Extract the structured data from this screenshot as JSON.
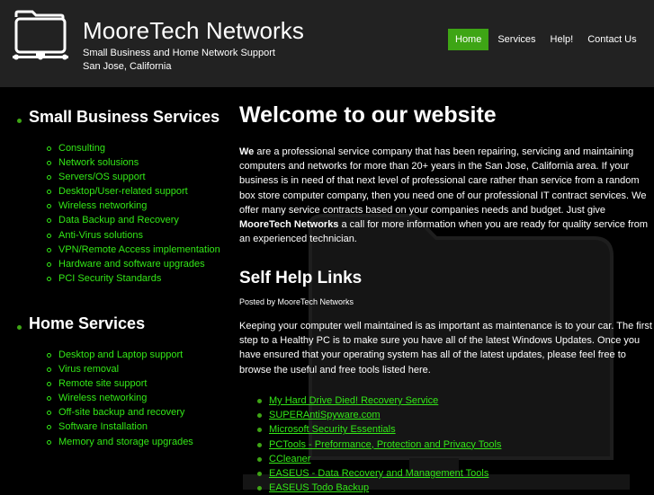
{
  "header": {
    "title": "MooreTech Networks",
    "tagline": "Small Business and Home Network Support",
    "location": "San Jose, California",
    "logo_icon": "computer-folder-icon"
  },
  "nav": {
    "items": [
      {
        "label": "Home",
        "active": true
      },
      {
        "label": "Services",
        "active": false
      },
      {
        "label": "Help!",
        "active": false
      },
      {
        "label": "Contact Us",
        "active": false
      }
    ]
  },
  "sidebar": {
    "small_business": {
      "heading": "Small Business Services",
      "items": [
        "Consulting",
        "Network solusions",
        "Servers/OS support",
        "Desktop/User-related support",
        "Wireless networking",
        "Data Backup and Recovery",
        "Anti-Virus solutions",
        "VPN/Remote Access implementation",
        "Hardware and software upgrades",
        "PCI Security Standards"
      ]
    },
    "home": {
      "heading": "Home Services",
      "items": [
        "Desktop and Laptop support",
        "Virus removal",
        "Remote site support",
        "Wireless networking",
        "Off-site backup and recovery",
        "Software Installation",
        "Memory and storage upgrades"
      ]
    }
  },
  "main": {
    "welcome_title": "Welcome to our website",
    "intro_bold_start": "We",
    "intro_text_1": " are a professional service company that has been repairing, servicing and maintaining computers and networks for more than 20+ years in the San Jose, California area. If your business is in need of that next level of professional care rather than service from a random box store computer company, then you need one of our professional IT contract services. We offer many service contracts based on your companies needs and budget. Just give ",
    "intro_bold_name": "MooreTech Networks",
    "intro_text_2": " a call for more information when you are ready for quality service from an experienced technician.",
    "selfhelp_title": "Self Help Links",
    "posted_by": "Posted by MooreTech Networks",
    "body": "Keeping your computer well maintained is as important as maintenance is to your car. The first step to a Healthy PC is to make sure you have all of the latest Windows Updates. Once you have ensured that your operating system has all of the latest updates, please feel free to browse the useful and free tools listed here.",
    "links": [
      "My Hard Drive Died! Recovery Service",
      "SUPERAntiSpyware.com",
      "Microsoft Security Essentials",
      "PCTools - Preformance, Protection and Privacy Tools",
      "CCleaner",
      "EASEUS - Data Recovery and Management Tools",
      "EASEUS Todo Backup"
    ]
  },
  "colors": {
    "accent": "#3ea515",
    "link": "#33e817",
    "header_bg": "#222222",
    "page_bg": "#000000"
  }
}
